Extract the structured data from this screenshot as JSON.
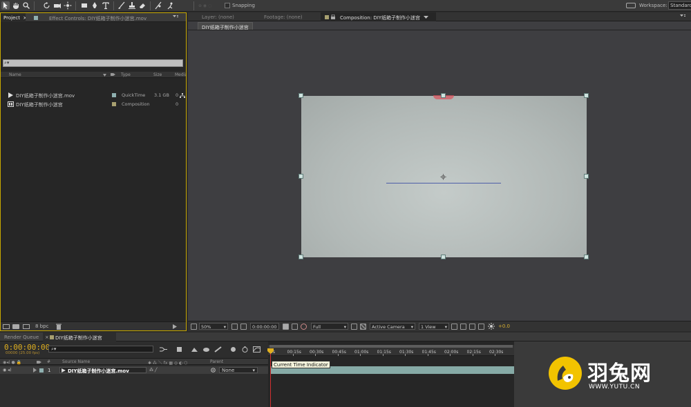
{
  "toolbar": {
    "snapping_label": "Snapping",
    "workspace_label": "Workspace:",
    "workspace_value": "Standard"
  },
  "project_panel": {
    "tab_project": "Project",
    "tab_effect_controls": "Effect Controls: DIY纸箱子制作小迷宫.mov",
    "search_placeholder": "⌕▾",
    "columns": {
      "name": "Name",
      "type": "Type",
      "size": "Size",
      "media": "Media"
    },
    "items": [
      {
        "name": "DIY纸箱子制作小迷宫.mov",
        "type": "QuickTime",
        "size": "3.1 GB",
        "extra": "0",
        "swatch": "#8fb0b0",
        "icon": "footage-icon"
      },
      {
        "name": "DIY纸箱子制作小迷宫",
        "type": "Composition",
        "size": "",
        "extra": "0",
        "swatch": "#a8a070",
        "icon": "composition-icon"
      }
    ],
    "bpc_label": "8 bpc"
  },
  "comp_panel": {
    "tab_layer": "Layer: (none)",
    "tab_footage": "Footage: (none)",
    "tab_composition": "Composition: DIY纸箱子制作小迷宫",
    "subtab": "DIY纸箱子制作小迷宫",
    "zoom": "50%",
    "timecode": "0:00:00:00",
    "resolution": "Full",
    "camera": "Active Camera",
    "view": "1 View",
    "exposure": "+0.0"
  },
  "timeline": {
    "tab_render_queue": "Render Queue",
    "tab_comp": "DIY纸箱子制作小迷宫",
    "timecode": "0:00:00:00",
    "fps": "00000 (25.00 fps)",
    "search_placeholder": "⌕▾",
    "col_num": "#",
    "col_source": "Source Name",
    "col_parent": "Parent",
    "layer": {
      "index": "1",
      "name": "DIY纸箱子制作小迷宫.mov",
      "parent": "None"
    },
    "ruler": [
      "0s",
      "00:15s",
      "00:30s",
      "00:45s",
      "01:00s",
      "01:15s",
      "01:30s",
      "01:45s",
      "02:00s",
      "02:15s",
      "02:30s"
    ],
    "tooltip": "Current Time Indicator"
  },
  "watermark": {
    "name": "羽兔网",
    "url": "WWW.YUTU.CN",
    "color": "#f2c300"
  }
}
